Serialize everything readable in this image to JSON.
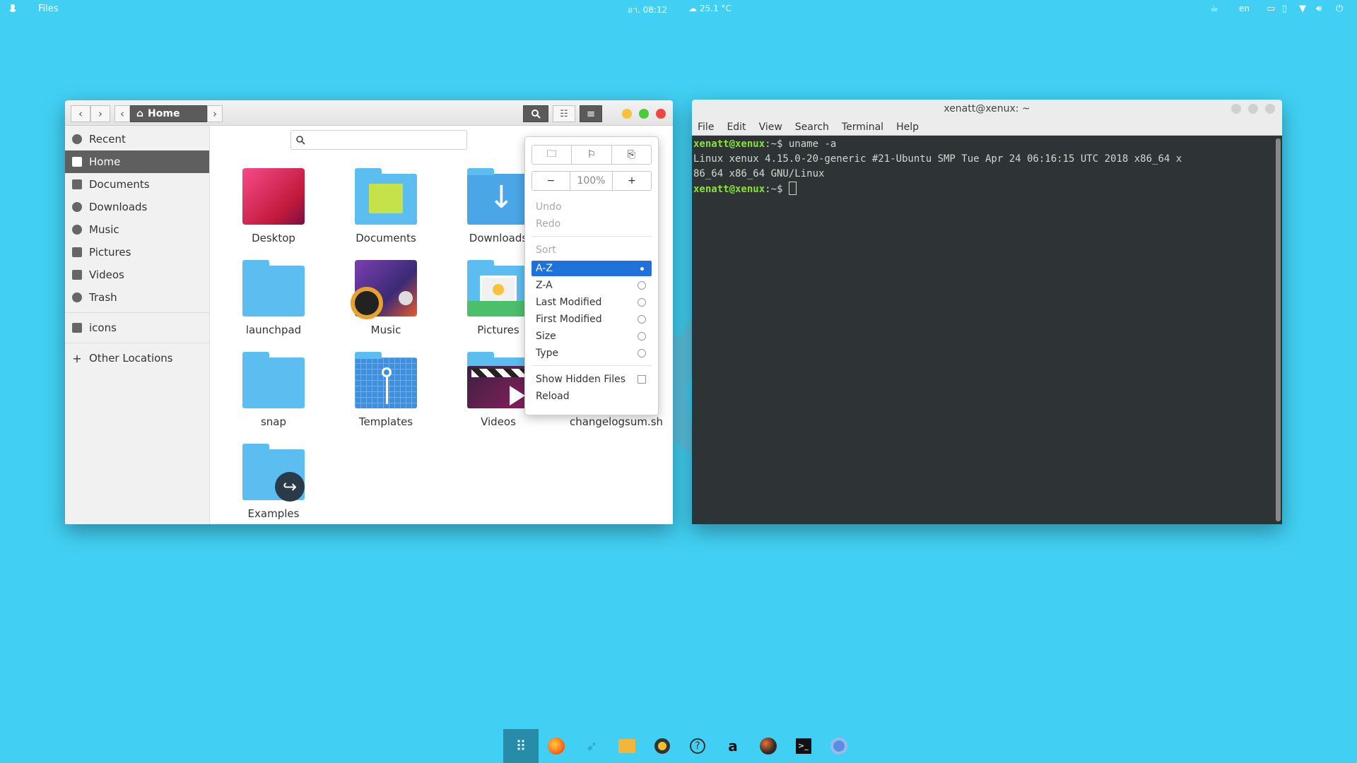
{
  "topbar": {
    "app_name": "Files",
    "clock": "อา. 08:12",
    "weather": "25.1 °C",
    "language": "en"
  },
  "files": {
    "breadcrumb": {
      "home_label": "Home"
    },
    "sidebar": {
      "items": [
        {
          "label": "Recent"
        },
        {
          "label": "Home"
        },
        {
          "label": "Documents"
        },
        {
          "label": "Downloads"
        },
        {
          "label": "Music"
        },
        {
          "label": "Pictures"
        },
        {
          "label": "Videos"
        },
        {
          "label": "Trash"
        }
      ],
      "bookmarks": [
        {
          "label": "icons"
        }
      ],
      "other_locations": "Other Locations"
    },
    "tiles": [
      {
        "label": "Desktop"
      },
      {
        "label": "Documents"
      },
      {
        "label": "Downloads"
      },
      {
        "label": "launchpad"
      },
      {
        "label": "Music"
      },
      {
        "label": "Pictures"
      },
      {
        "label": "snap"
      },
      {
        "label": "Templates"
      },
      {
        "label": "Videos"
      },
      {
        "label": "changelogsum.sh"
      },
      {
        "label": "Examples"
      }
    ],
    "menu": {
      "zoom": "100%",
      "undo": "Undo",
      "redo": "Redo",
      "sort_header": "Sort",
      "sort_options": [
        "A-Z",
        "Z-A",
        "Last Modified",
        "First Modified",
        "Size",
        "Type"
      ],
      "selected_sort": "A-Z",
      "show_hidden": "Show Hidden Files",
      "reload": "Reload"
    }
  },
  "terminal": {
    "title": "xenatt@xenux: ~",
    "menu": [
      "File",
      "Edit",
      "View",
      "Search",
      "Terminal",
      "Help"
    ],
    "prompt": "xenatt@xenux",
    "prompt_suffix": ":~$ ",
    "command": "uname -a",
    "output_line1": "Linux xenux 4.15.0-20-generic #21-Ubuntu SMP Tue Apr 24 06:16:15 UTC 2018 x86_64 x",
    "output_line2": "86_64 x86_64 GNU/Linux"
  },
  "colors": {
    "desktop_bg": "#41d0f3",
    "selection": "#1f72d9",
    "terminal_bg": "#2e3436",
    "prompt_green": "#8ae234"
  }
}
